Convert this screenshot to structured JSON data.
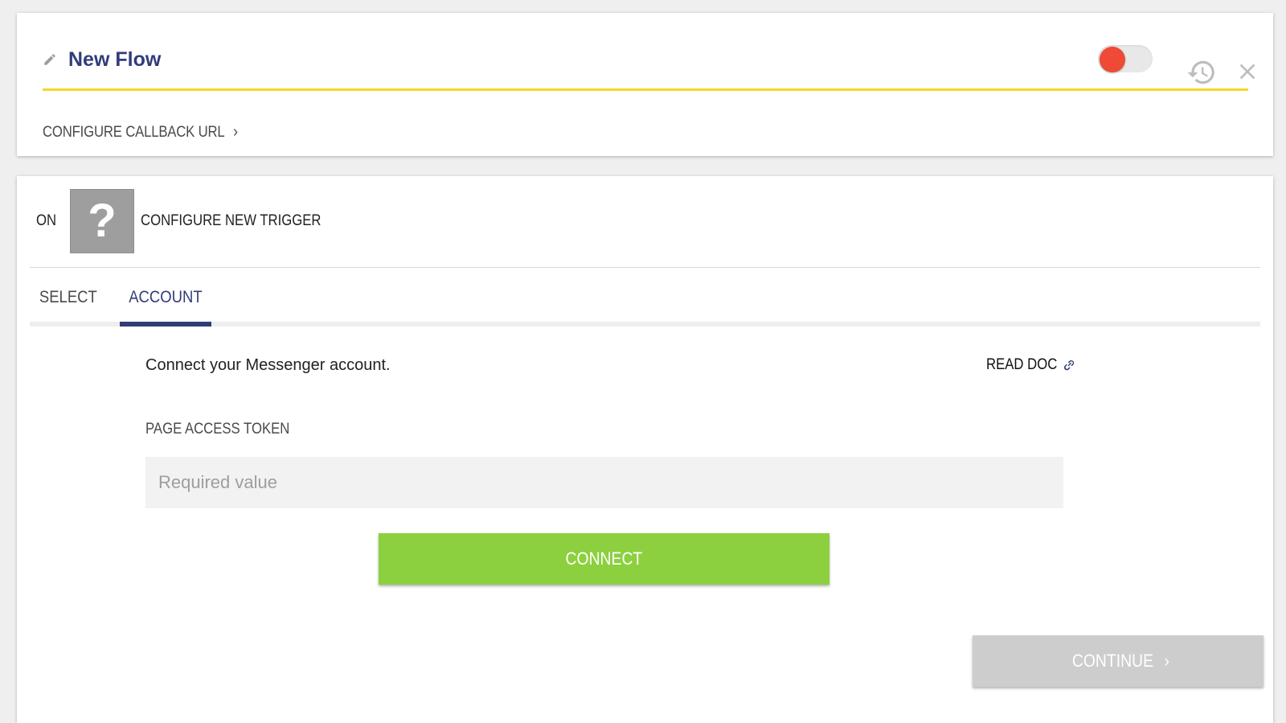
{
  "header": {
    "title": "New Flow",
    "callback_link": "CONFIGURE CALLBACK URL",
    "chevron": "›",
    "toggle_state": "off",
    "colors": {
      "title": "#323d78",
      "accent_bar": "#f3d72c",
      "toggle_knob": "#ef4a36"
    },
    "icons": [
      "pencil-icon",
      "history-icon",
      "close-icon"
    ]
  },
  "trigger": {
    "prefix": "ON",
    "icon_glyph": "?",
    "title": "CONFIGURE NEW TRIGGER"
  },
  "tabs": [
    {
      "label": "SELECT",
      "active": false
    },
    {
      "label": "ACCOUNT",
      "active": true
    }
  ],
  "account": {
    "description": "Connect your Messenger account.",
    "read_doc": "READ DOC",
    "field_label": "PAGE ACCESS TOKEN",
    "field_placeholder": "Required value",
    "field_value": "",
    "connect_label": "CONNECT",
    "continue_label": "CONTINUE",
    "continue_chevron": "›",
    "colors": {
      "connect": "#8cd03f",
      "continue_disabled": "#cdcdcd"
    }
  }
}
